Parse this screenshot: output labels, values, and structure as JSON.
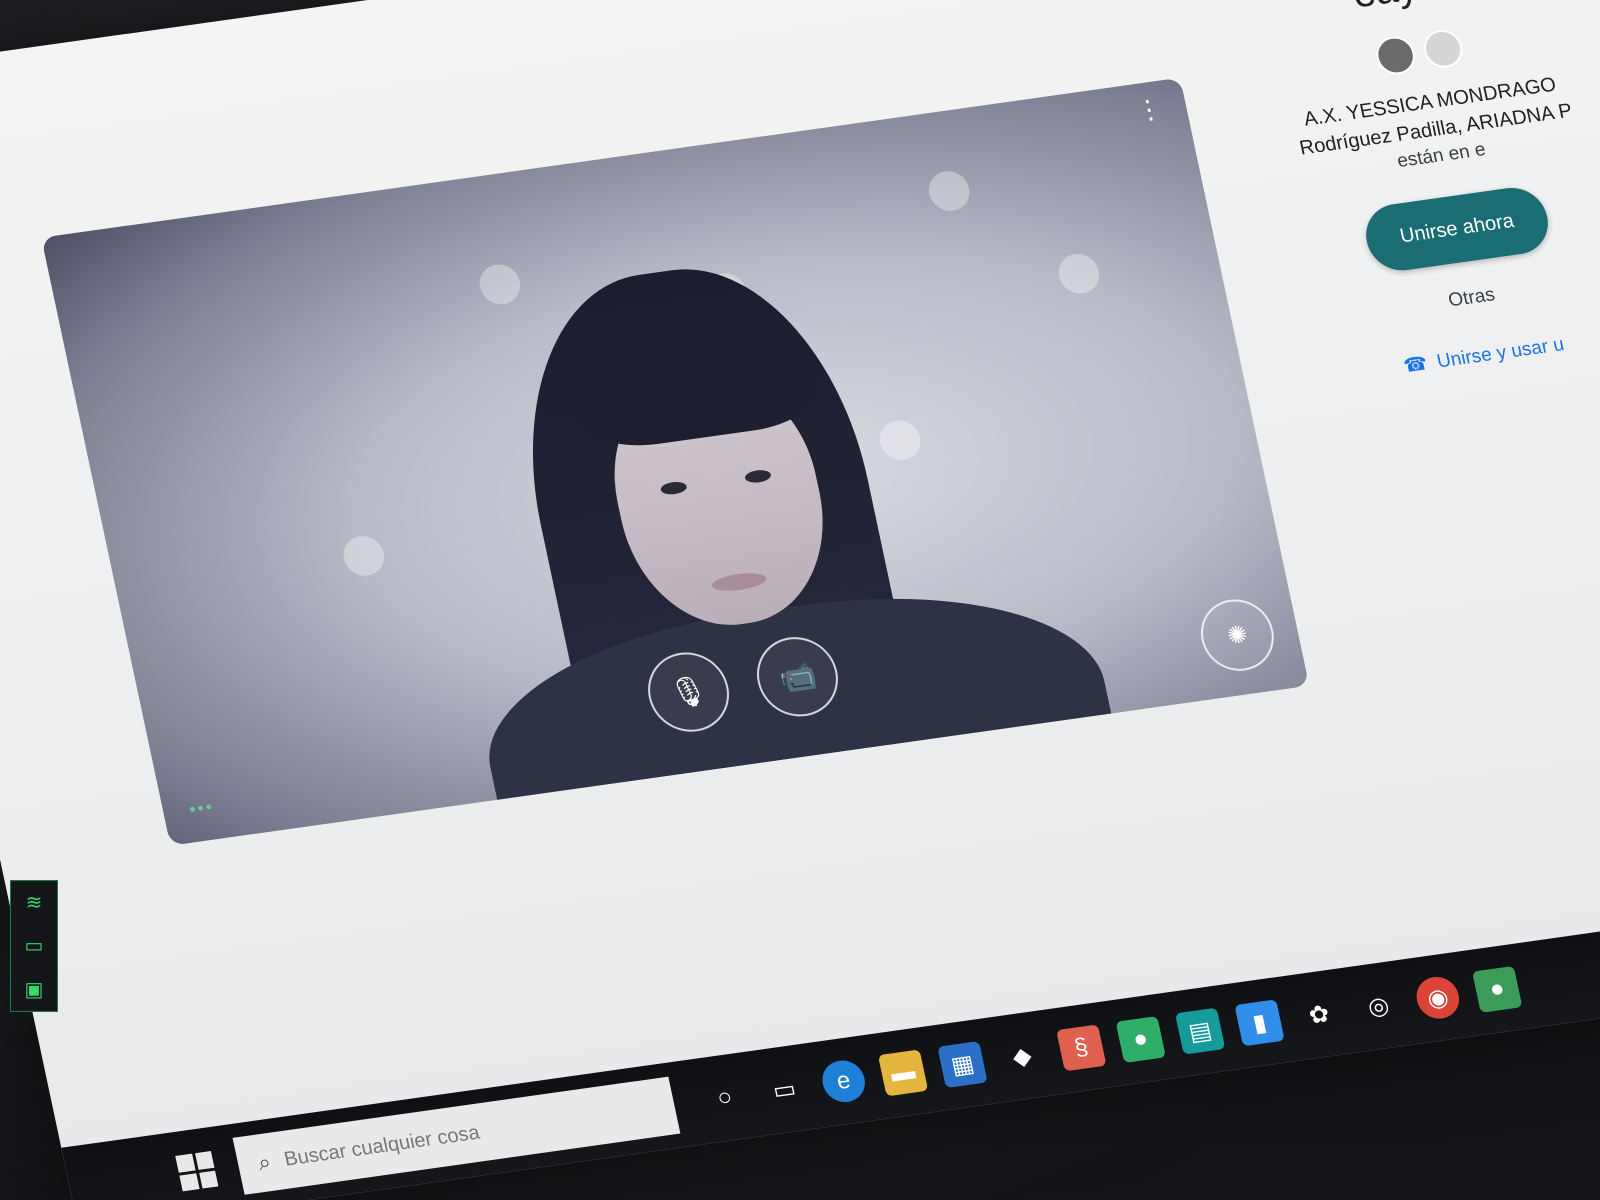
{
  "meeting": {
    "title": "eayva",
    "participants_line1": "A.X. YESSICA MONDRAGO",
    "participants_line2": "Rodríguez Padilla, ARIADNA P",
    "participants_status": "están en e"
  },
  "actions": {
    "join_now": "Unirse ahora",
    "other_options": "Otras",
    "join_phone": "Unirse y usar u"
  },
  "video": {
    "more_icon": "⋮",
    "mic_icon": "🎙",
    "camera_icon": "📹",
    "effects_icon": "✺",
    "status_dots": "•••"
  },
  "taskbar": {
    "search_placeholder": "Buscar cualquier cosa",
    "icons": [
      "windows-start-icon",
      "search-icon",
      "cortana-icon",
      "task-view-icon",
      "edge-icon",
      "file-explorer-icon",
      "store-icon",
      "dropbox-icon",
      "app-red-icon",
      "app-green-icon",
      "app-teal-icon",
      "app-blue-icon",
      "app-misc-icon",
      "app-circle-icon",
      "chrome-icon",
      "app-green2-icon"
    ]
  },
  "tray": {
    "wifi": "wifi-icon",
    "battery": "battery-icon",
    "cpu": "cpu-icon",
    "more": "•••"
  },
  "colors": {
    "accent": "#1a6e73",
    "link": "#1a73e8",
    "tray_green": "#39d66a"
  }
}
